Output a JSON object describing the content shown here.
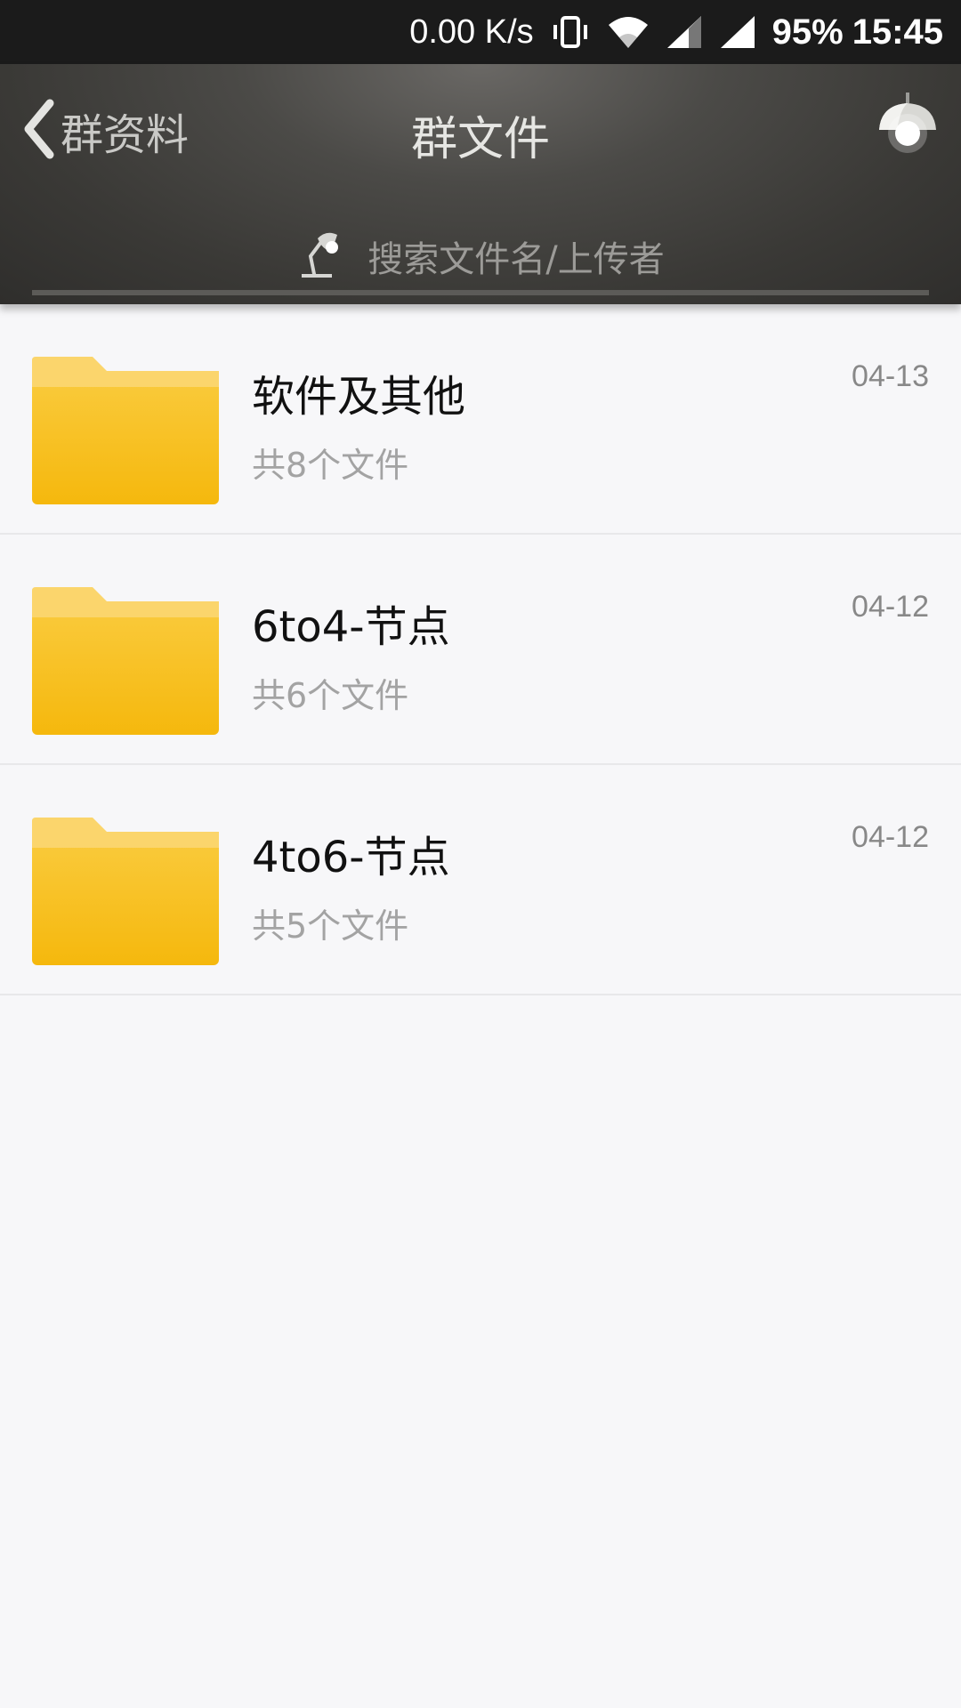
{
  "status_bar": {
    "net_speed": "0.00 K/s",
    "battery": "95%",
    "time": "15:45",
    "icons": [
      "vibrate-icon",
      "wifi-icon",
      "signal-icon",
      "signal-icon"
    ]
  },
  "header": {
    "back_label": "群资料",
    "title": "群文件",
    "search_placeholder": "搜索文件名/上传者",
    "icons": [
      "back-chevron-icon",
      "ceiling-lamp-icon",
      "desk-lamp-icon"
    ]
  },
  "files": [
    {
      "name": "软件及其他",
      "count": "共8个文件",
      "date": "04-13",
      "icon": "folder-icon"
    },
    {
      "name": "6to4-节点",
      "count": "共6个文件",
      "date": "04-12",
      "icon": "folder-icon"
    },
    {
      "name": "4to6-节点",
      "count": "共5个文件",
      "date": "04-12",
      "icon": "folder-icon"
    }
  ],
  "colors": {
    "folder": "#F7BE16",
    "folder_tab": "#FBD56C",
    "header_dark": "#3A3936",
    "background": "#F7F7F9"
  }
}
